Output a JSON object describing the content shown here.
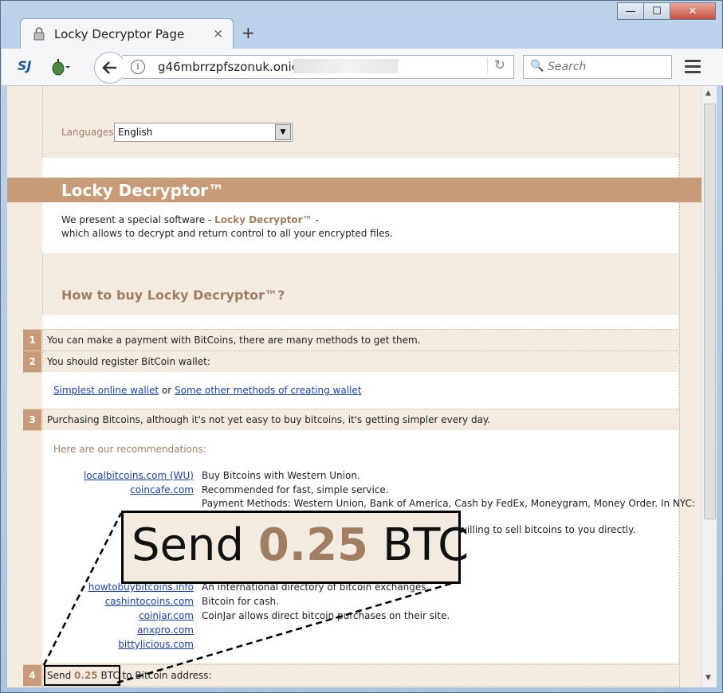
{
  "window": {
    "minimize": "—",
    "maximize": "☐",
    "close": "✕"
  },
  "tab": {
    "title": "Locky Decryptor Page",
    "close": "×",
    "new_tab": "+"
  },
  "toolbar": {
    "url": "g46mbrrzpfszonuk.onion/",
    "search_placeholder": "Search",
    "logo": "SJ"
  },
  "page": {
    "lang_label": "Languages:",
    "lang_value": "English",
    "title": "Locky Decryptor™",
    "intro_1": "We present a special software - ",
    "intro_product": "Locky Decryptor™",
    "intro_1b": " -",
    "intro_2": "which allows to decrypt and return control to all your encrypted files.",
    "howto": "How to buy Locky Decryptor™?",
    "steps": [
      {
        "num": "1",
        "text": "You can make a payment with BitCoins, there are many methods to get them."
      },
      {
        "num": "2",
        "text": "You should register BitCoin wallet:"
      },
      {
        "num": "3",
        "text": "Purchasing Bitcoins, although it's not yet easy to buy bitcoins, it's getting simpler every day."
      },
      {
        "num": "4",
        "text_pre": "Send ",
        "amount": "0.25",
        "text_post": " BTC to Bitcoin address:"
      }
    ],
    "wallet_link_1": "Simplest online wallet",
    "wallet_or": "or",
    "wallet_link_2": "Some other methods of creating wallet",
    "rec_title": "Here are our recommendations:",
    "sites": [
      {
        "name": "localbitcoins.com (WU)",
        "desc": "Buy Bitcoins with Western Union."
      },
      {
        "name": "coincafe.com",
        "desc": "Recommended for fast, simple service."
      },
      {
        "name": "",
        "desc": "Payment Methods: Western Union, Bank of America, Cash by FedEx, Moneygram, Money Order. In NYC:"
      },
      {
        "name": "",
        "desc": "willing to sell bitcoins to you directly."
      },
      {
        "name": "howtobuybitcoins.info",
        "desc": "An international directory of bitcoin exchanges."
      },
      {
        "name": "cashintocoins.com",
        "desc": "Bitcoin for cash."
      },
      {
        "name": "coinjar.com",
        "desc": "CoinJar allows direct bitcoin purchases on their site."
      },
      {
        "name": "anxpro.com",
        "desc": ""
      },
      {
        "name": "bittylicious.com",
        "desc": ""
      }
    ],
    "zoom": {
      "pre": "Send ",
      "amount": "0.25",
      "post": " BTC"
    }
  }
}
